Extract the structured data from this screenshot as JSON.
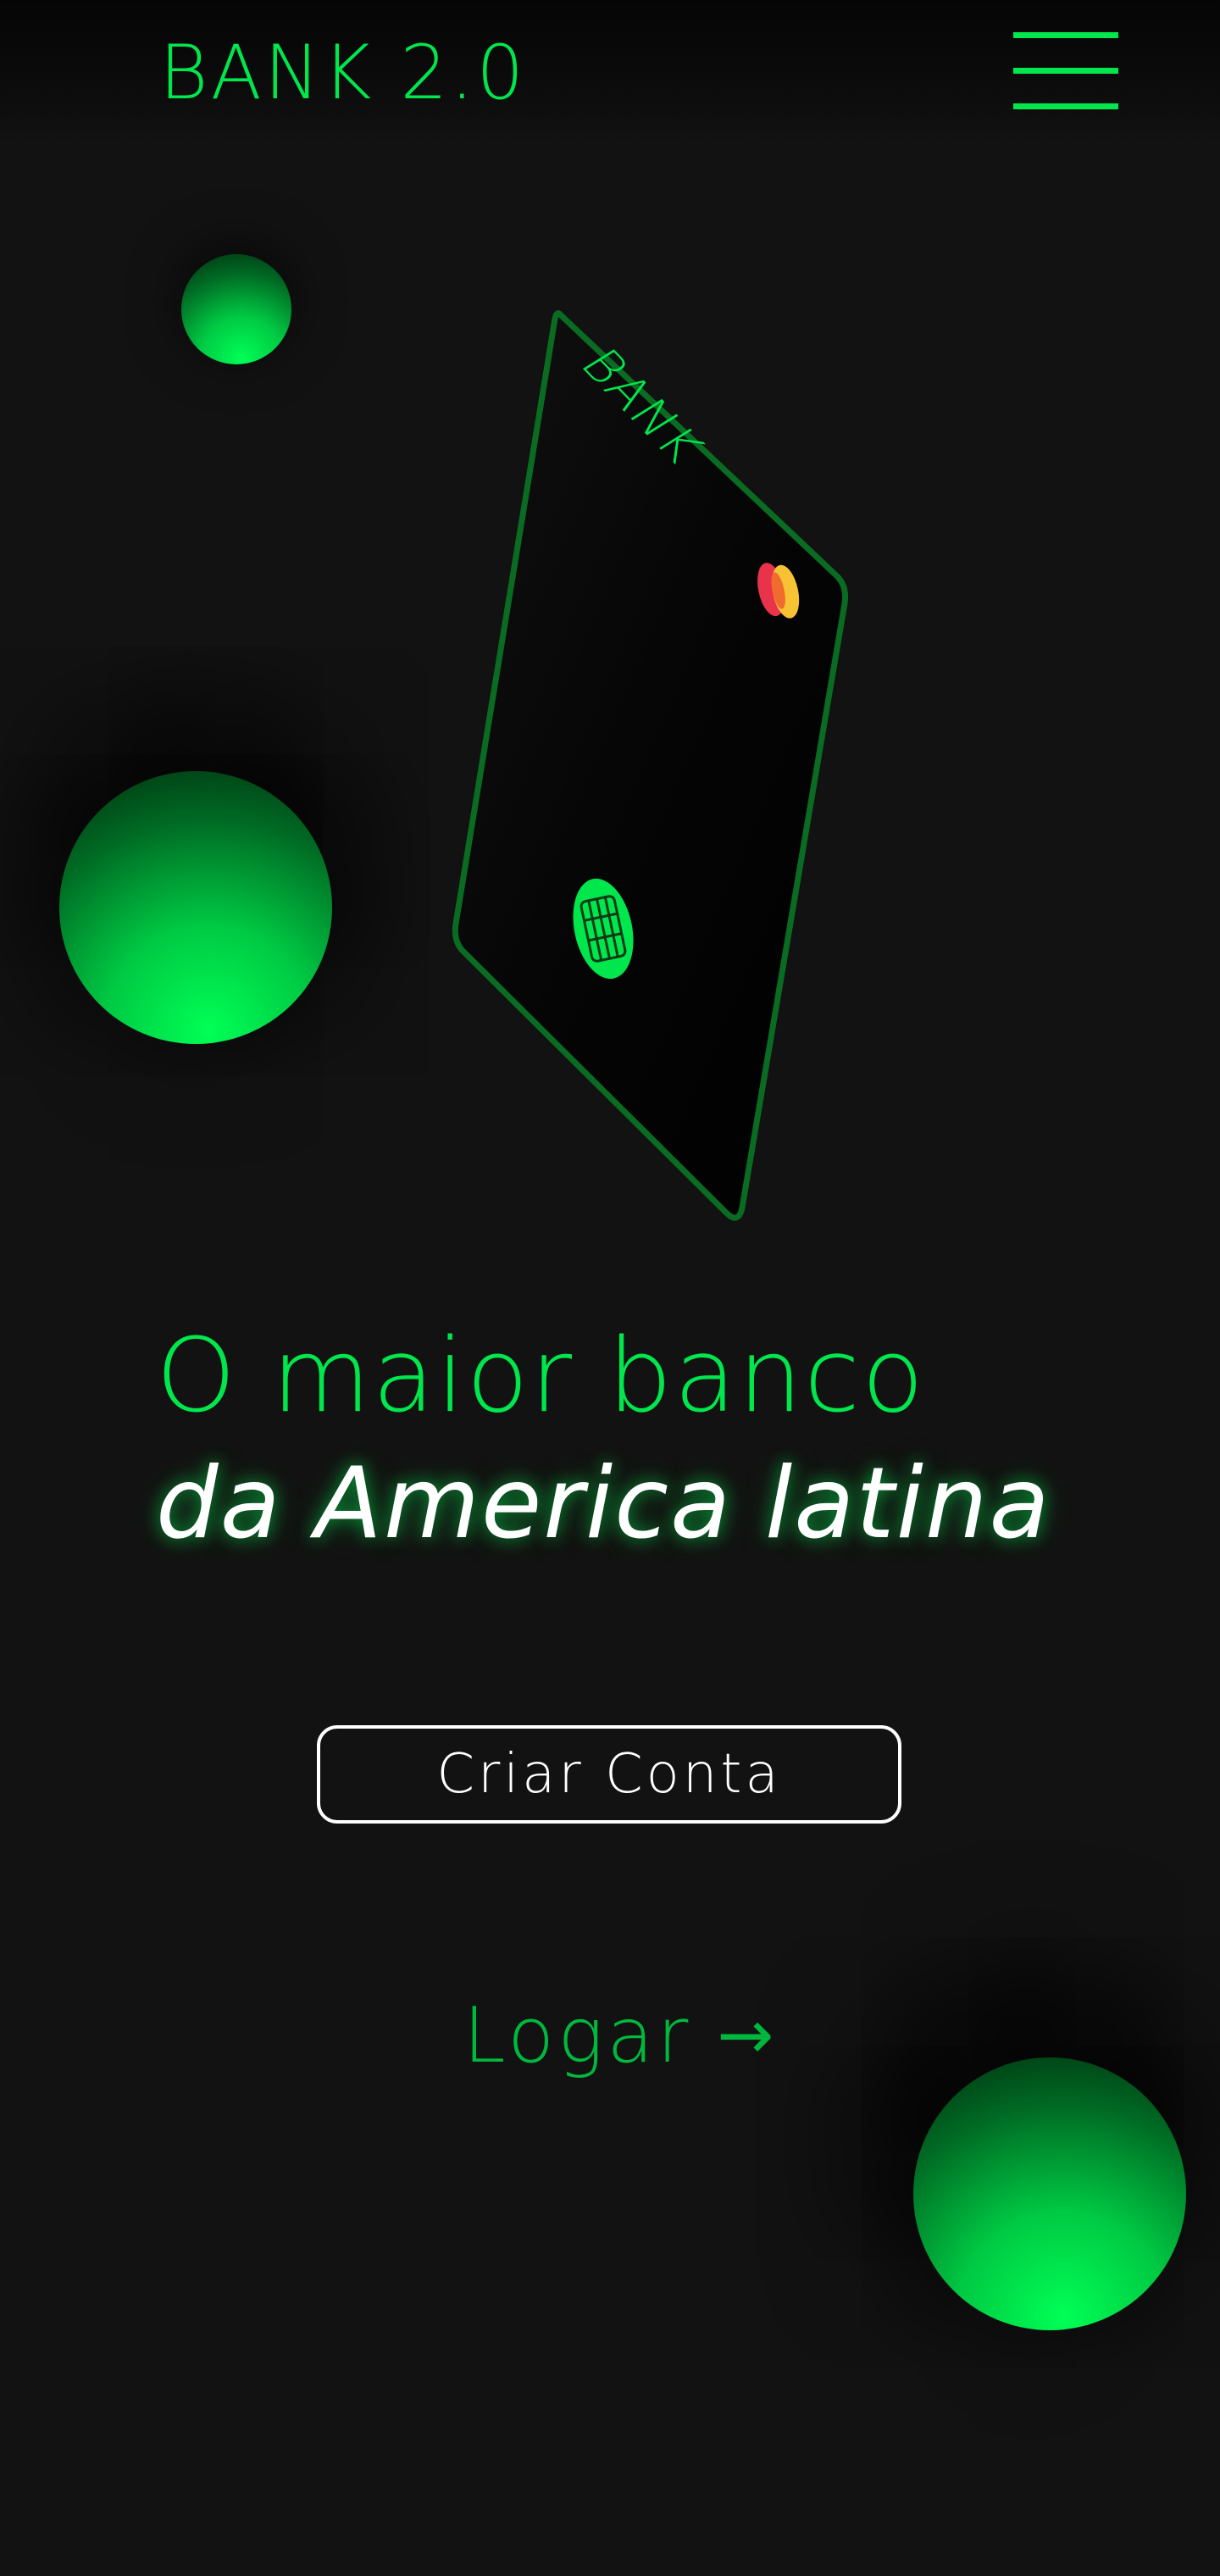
{
  "header": {
    "logo": "BANK 2.0",
    "menu_icon": "hamburger-menu-icon"
  },
  "card": {
    "brand": "BANK",
    "chip_icon": "chip-icon",
    "network_icon": "mastercard-logo-icon"
  },
  "hero": {
    "line1": "O maior banco",
    "line2": "da America latina"
  },
  "actions": {
    "create_account_label": "Criar Conta",
    "login_label": "Logar",
    "login_arrow": "→"
  },
  "colors": {
    "background": "#121212",
    "accent": "#00e64d",
    "accent_dark": "#00b83e",
    "text_light": "#ffffff",
    "card_border": "#0a5a1c",
    "card_red": "#e8334a",
    "card_yellow": "#f7c234"
  }
}
